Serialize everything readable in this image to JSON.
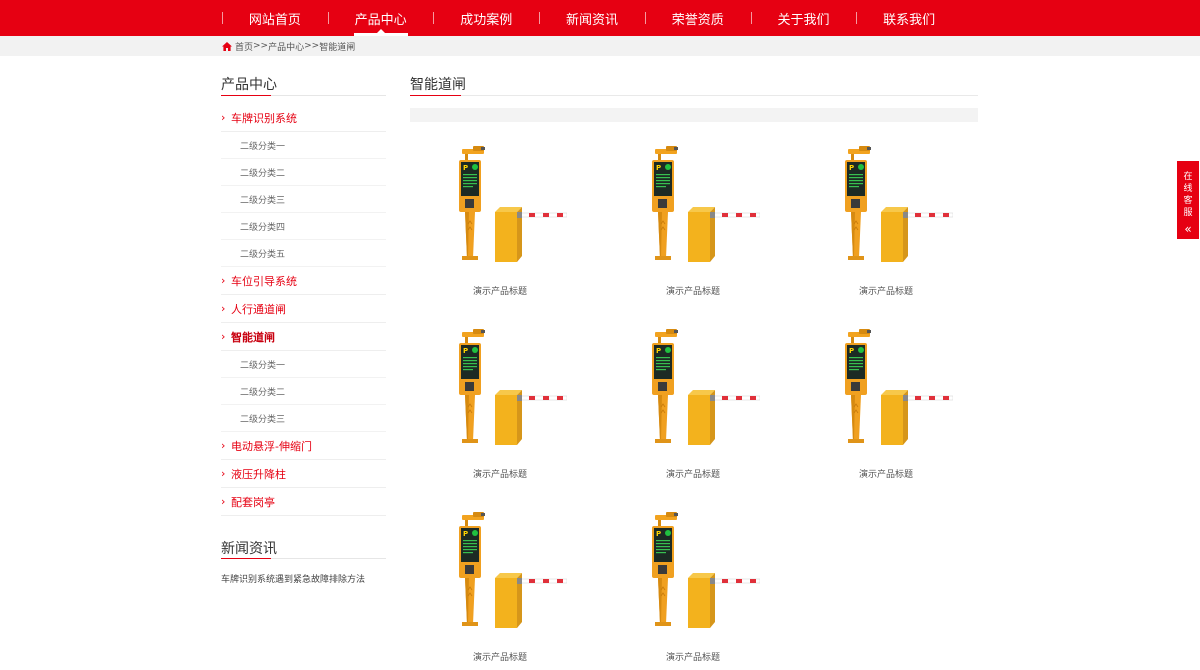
{
  "nav": {
    "items": [
      {
        "label": "网站首页",
        "active": false
      },
      {
        "label": "产品中心",
        "active": true
      },
      {
        "label": "成功案例",
        "active": false
      },
      {
        "label": "新闻资讯",
        "active": false
      },
      {
        "label": "荣誉资质",
        "active": false
      },
      {
        "label": "关于我们",
        "active": false
      },
      {
        "label": "联系我们",
        "active": false
      }
    ]
  },
  "breadcrumb": {
    "home_icon": "home-icon",
    "home": "首页",
    "sep1": ">>",
    "products": "产品中心",
    "sep2": ">>",
    "current": "智能道闸"
  },
  "sidebar": {
    "title": "产品中心",
    "categories": [
      {
        "label": "车牌识别系统",
        "subs": [
          "二级分类一",
          "二级分类二",
          "二级分类三",
          "二级分类四",
          "二级分类五"
        ]
      },
      {
        "label": "车位引导系统",
        "subs": []
      },
      {
        "label": "人行通道闸",
        "subs": []
      },
      {
        "label": "智能道闸",
        "current": true,
        "subs": [
          "二级分类一",
          "二级分类二",
          "二级分类三"
        ]
      },
      {
        "label": "电动悬浮-伸缩门",
        "subs": []
      },
      {
        "label": "液压升降柱",
        "subs": []
      },
      {
        "label": "配套岗亭",
        "subs": []
      }
    ],
    "news_title": "新闻资讯",
    "news_items": [
      "车牌识别系统遇到紧急故障排除方法"
    ]
  },
  "main": {
    "title": "智能道闸",
    "products": [
      {
        "caption": "演示产品标题"
      },
      {
        "caption": "演示产品标题"
      },
      {
        "caption": "演示产品标题"
      },
      {
        "caption": "演示产品标题"
      },
      {
        "caption": "演示产品标题"
      },
      {
        "caption": "演示产品标题"
      },
      {
        "caption": "演示产品标题"
      },
      {
        "caption": "演示产品标题"
      }
    ]
  },
  "service": {
    "label": "在线客服",
    "icon": "double-chevron-left-icon"
  },
  "colors": {
    "brand_red": "#e60012",
    "barrier_orange": "#f0a020",
    "bg_gray": "#f2f2f2"
  }
}
